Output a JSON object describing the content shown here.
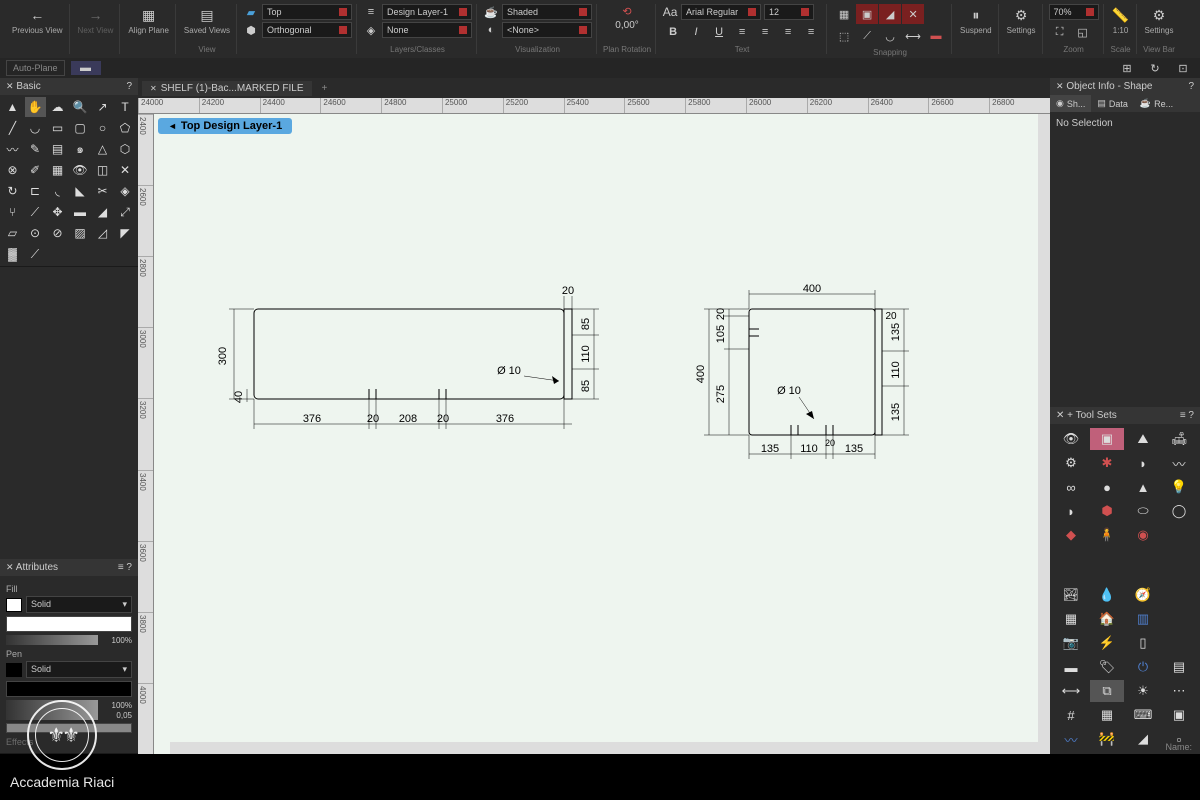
{
  "toolbar": {
    "prev_view": "Previous\nView",
    "next_view": "Next\nView",
    "align_plane": "Align\nPlane",
    "saved_views": "Saved\nViews",
    "view_label": "View",
    "plane_top": "Top",
    "plane_ortho": "Orthogonal",
    "layer": "Design Layer-1",
    "class": "None",
    "layers_classes": "Layers/Classes",
    "render": "Shaded",
    "render_none": "<None>",
    "visualization": "Visualization",
    "plan_rot_val": "0,00°",
    "plan_rotation": "Plan Rotation",
    "font_label": "Aa",
    "font_name": "Arial Regular",
    "font_size": "12",
    "text_label": "Text",
    "snapping": "Snapping",
    "suspend": "Suspend",
    "settings": "Settings",
    "zoom_val": "70%",
    "zoom": "Zoom",
    "scale_val": "1:10",
    "scale": "Scale",
    "viewbar_settings": "Settings",
    "viewbar": "View Bar"
  },
  "toolbar2": {
    "auto_plane": "Auto-Plane"
  },
  "left": {
    "basic": "Basic",
    "attributes": "Attributes",
    "fill": "Fill",
    "pen": "Pen",
    "solid": "Solid",
    "opacity100": "100%",
    "thickness": "0,05",
    "effects": "Effects"
  },
  "tabs": {
    "file_name": "SHELF (1)-Bac...MARKED FILE"
  },
  "ruler_h": [
    "24000",
    "24200",
    "24400",
    "24600",
    "24800",
    "25000",
    "25200",
    "25400",
    "25600",
    "25800",
    "26000",
    "26200",
    "26400",
    "26600",
    "26800"
  ],
  "ruler_v": [
    "2400",
    "2600",
    "2800",
    "3000",
    "3200",
    "3400",
    "3600",
    "3800",
    "4000"
  ],
  "view_badge": "Top  Design Layer-1",
  "right": {
    "obj_info": "Object Info - Shape",
    "tab_shape": "Sh...",
    "tab_data": "Data",
    "tab_render": "Re...",
    "no_selection": "No Selection",
    "tool_sets": "Tool Sets",
    "name_label": "Name:"
  },
  "drawing": {
    "part1": {
      "h": "300",
      "h2": "40",
      "w1": "376",
      "w2": "20",
      "w3": "208",
      "w4": "20",
      "w5": "376",
      "top_20": "20",
      "r85a": "85",
      "r110": "110",
      "r85b": "85",
      "dia": "Ø 10"
    },
    "part2": {
      "w_top": "400",
      "h_left": "400",
      "l20": "20",
      "l105": "105",
      "l275": "275",
      "r20": "20",
      "r135a": "135",
      "r110": "110",
      "r135b": "135",
      "b135a": "135",
      "b110": "110",
      "b20": "20",
      "b135b": "135",
      "dia": "Ø 10"
    }
  },
  "watermark": "Accademia Riaci"
}
